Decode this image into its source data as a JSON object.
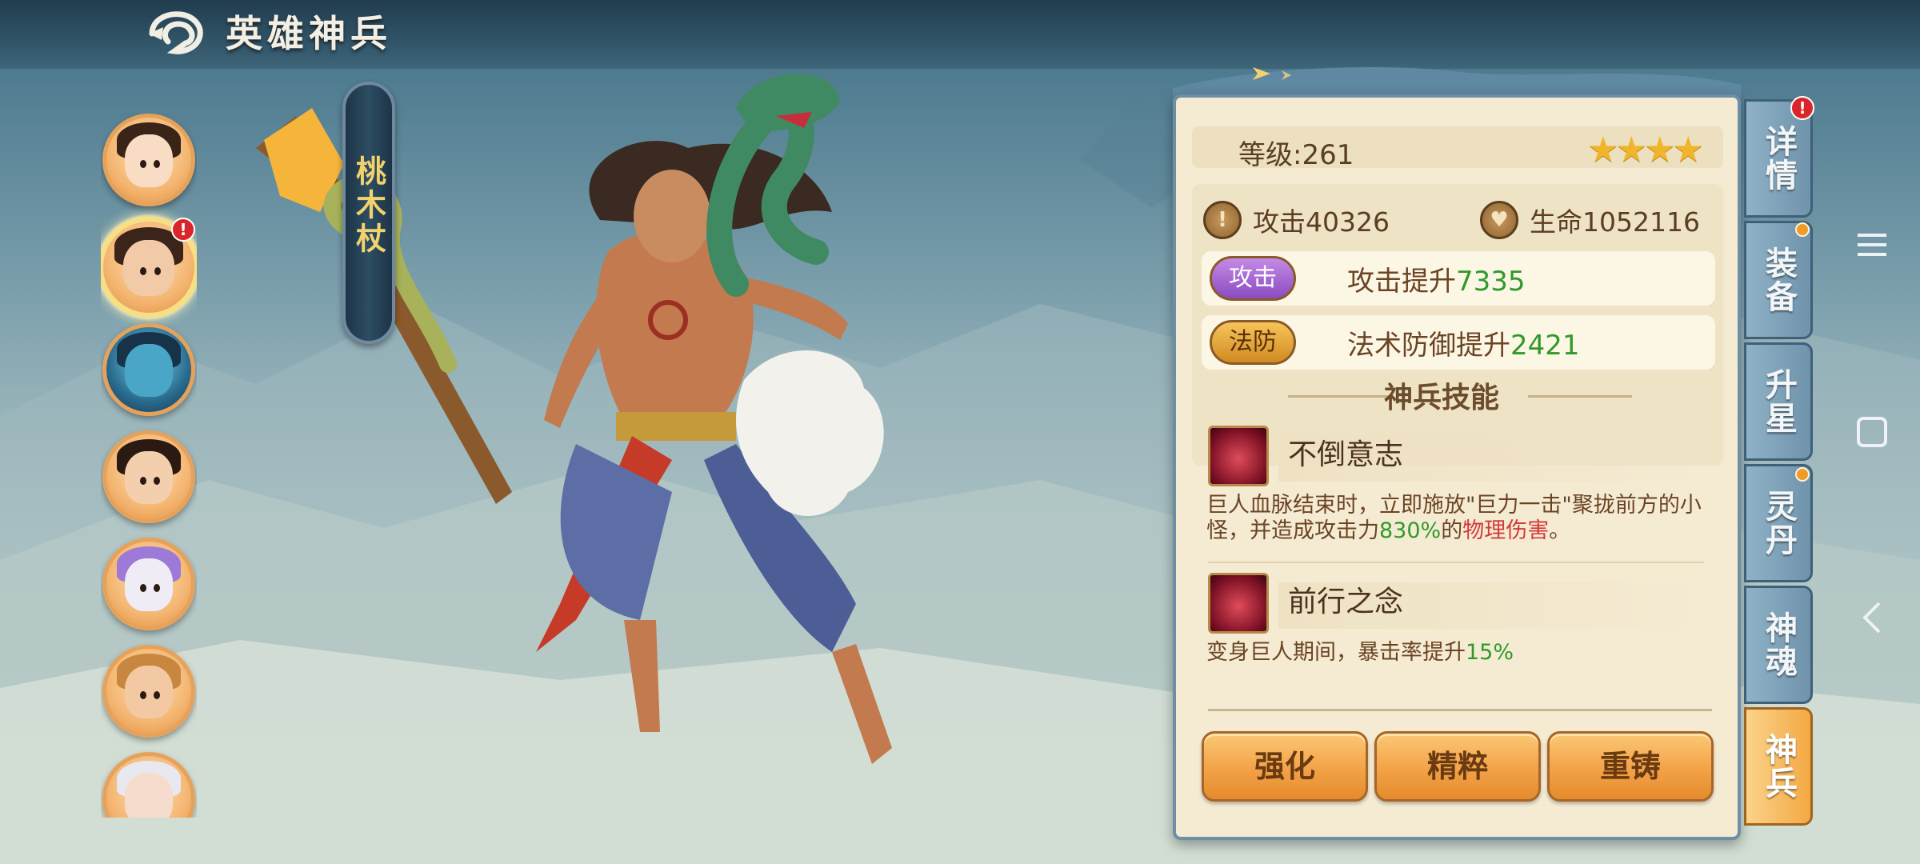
{
  "header": {
    "title": "英雄神兵"
  },
  "weapon": {
    "name": "桃木杖"
  },
  "heroes": {
    "alert": "!"
  },
  "panel": {
    "level_text": "等级:261",
    "stars": "★★★★",
    "attack_label": "攻击40326",
    "hp_label": "生命1052116",
    "bonuses": [
      {
        "tag": "攻击",
        "text": "攻击提升",
        "value": "7335"
      },
      {
        "tag": "法防",
        "text": "法术防御提升",
        "value": "2421"
      }
    ],
    "skills_title": "神兵技能",
    "skills": [
      {
        "name": "不倒意志",
        "desc_a": "巨人血脉结束时，立即施放\"巨力一击\"聚拢前方的小怪，并造成攻击力",
        "desc_b": "830%",
        "desc_c": "的",
        "desc_d": "物理伤害",
        "desc_e": "。"
      },
      {
        "name": "前行之念",
        "desc_a": "变身巨人期间，暴击率提升",
        "desc_b": "15%"
      }
    ],
    "buttons": {
      "enhance": "强化",
      "essence": "精粹",
      "recast": "重铸"
    }
  },
  "tabs": [
    {
      "label": "详情"
    },
    {
      "label": "装备"
    },
    {
      "label": "升星"
    },
    {
      "label": "灵丹"
    },
    {
      "label": "神魂"
    },
    {
      "label": "神兵"
    }
  ],
  "colors": {
    "accent_orange": "#f3a248",
    "tab_blue": "#7ea3ba",
    "panel_bg": "#f5ebd3",
    "value_green": "#2f9a2a",
    "damage_red": "#d23a3a"
  }
}
